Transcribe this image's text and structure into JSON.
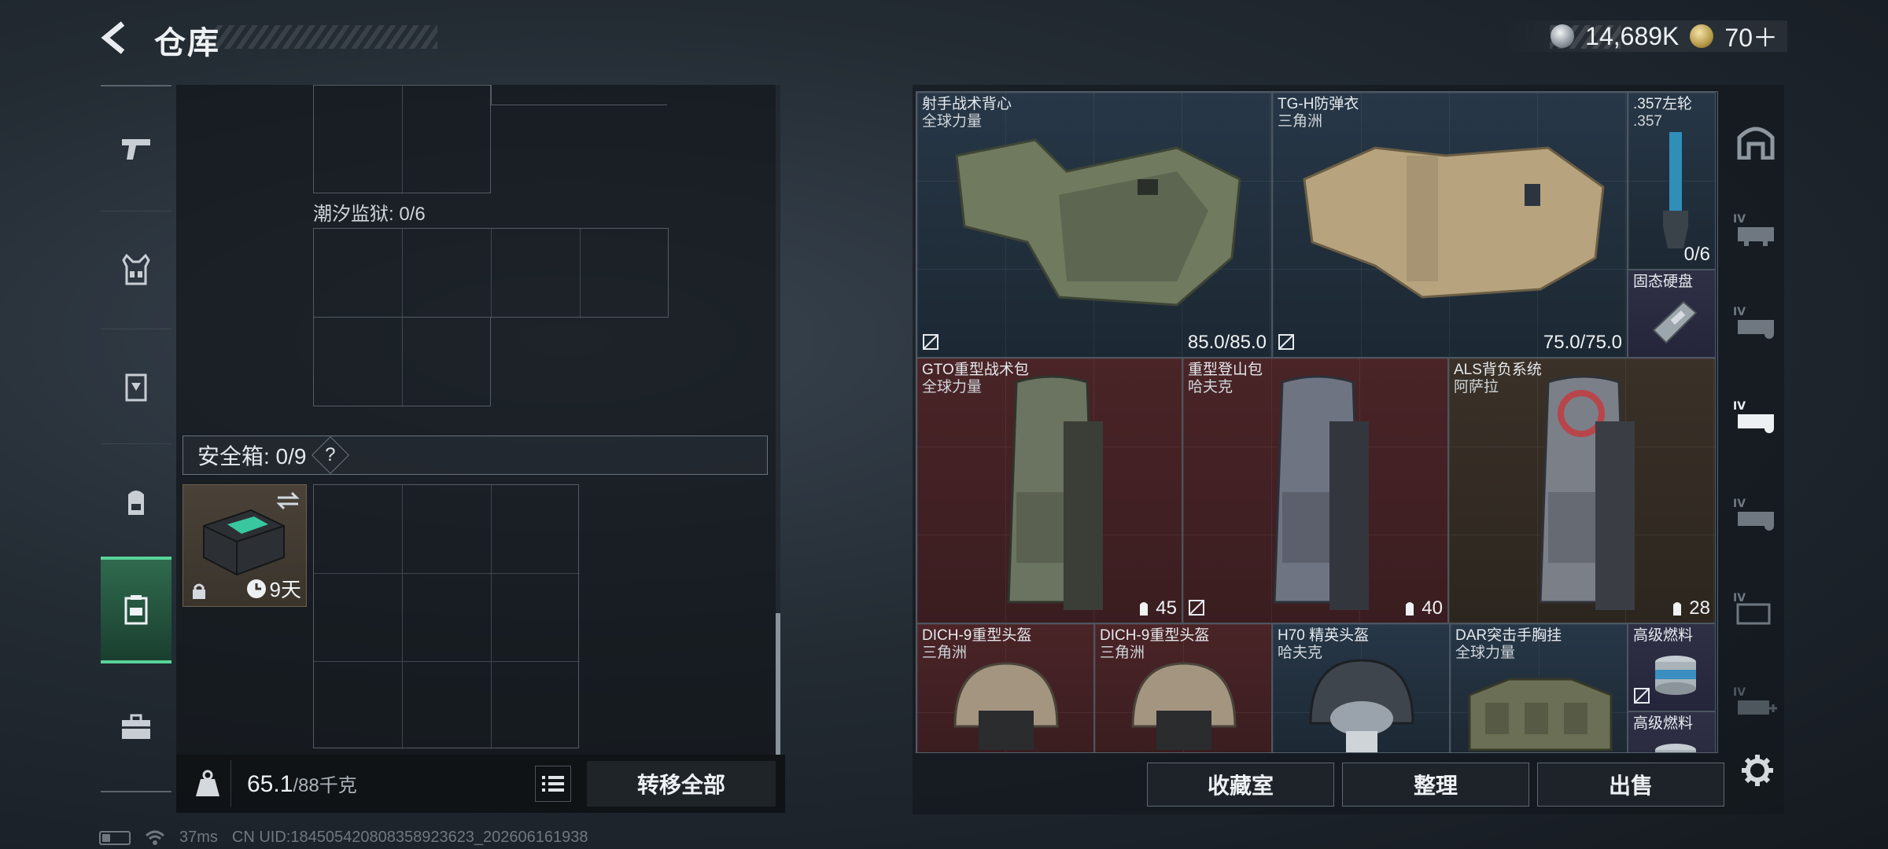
{
  "header": {
    "title": "仓库"
  },
  "currency": {
    "silver": "14,689K",
    "gold": "70＋"
  },
  "left_panel": {
    "tide_prison_label": "潮汐监狱: 0/6",
    "safe_box_label": "安全箱: 0/9",
    "help": "?",
    "safe_item_days": "9天"
  },
  "weight": {
    "current": "65.1",
    "max": "/88千克"
  },
  "transfer_all": "转移全部",
  "status": {
    "ping": "37ms",
    "uid": "CN UID:18450542080835892362​3_202606161938"
  },
  "inventory": [
    {
      "name": "射手战术背心",
      "maker": "全球力量",
      "stat": "85.0/85.0",
      "color": "blue"
    },
    {
      "name": "TG-H防弹衣",
      "maker": "三角洲",
      "stat": "75.0/75.0",
      "color": "blue"
    },
    {
      "name": ".357左轮",
      "maker": ".357",
      "stat": "0/6",
      "color": "blue"
    },
    {
      "name": "固态硬盘",
      "maker": "",
      "stat": "",
      "color": "purple"
    },
    {
      "name": "GTO重型战术包",
      "maker": "全球力量",
      "stat": "45",
      "color": "red"
    },
    {
      "name": "重型登山包",
      "maker": "哈夫克",
      "stat": "40",
      "color": "red"
    },
    {
      "name": "ALS背负系统",
      "maker": "阿萨拉",
      "stat": "28",
      "color": "brown"
    },
    {
      "name": "DICH-9重型头盔",
      "maker": "三角洲",
      "stat": "",
      "color": "red"
    },
    {
      "name": "DICH-9重型头盔",
      "maker": "三角洲",
      "stat": "",
      "color": "red"
    },
    {
      "name": "H70 精英头盔",
      "maker": "哈夫克",
      "stat": "",
      "color": "blue"
    },
    {
      "name": "DAR突击手胸挂",
      "maker": "全球力量",
      "stat": "",
      "color": "blue"
    },
    {
      "name": "高级燃料",
      "maker": "",
      "stat": "",
      "color": "purple"
    },
    {
      "name": "高级燃料",
      "maker": "",
      "stat": "",
      "color": "purple"
    }
  ],
  "buttons": {
    "collection": "收藏室",
    "organize": "整理",
    "sell": "出售"
  },
  "icons": {
    "back": "chevron-left-icon",
    "nav": [
      "pistol-icon",
      "vest-icon",
      "armor-icon",
      "backpack-icon",
      "safe-box-icon",
      "briefcase-icon"
    ],
    "right_nav": [
      "home-icon",
      "storage-iv-1-icon",
      "storage-iv-2-icon",
      "storage-iv-3-icon",
      "storage-iv-4-icon",
      "storage-iv-5-icon",
      "storage-iv-add-icon"
    ]
  }
}
